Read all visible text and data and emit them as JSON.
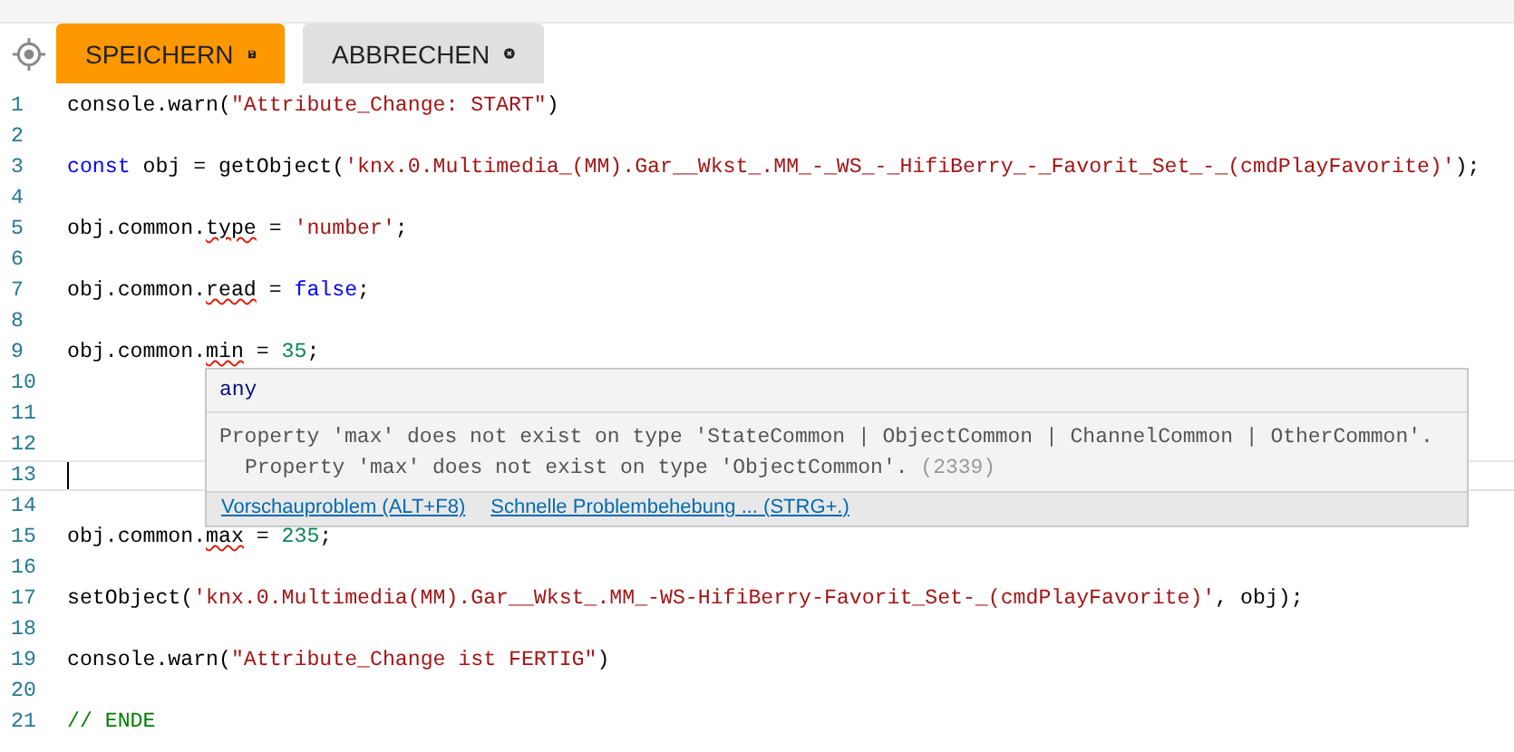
{
  "toolbar": {
    "buttons": [
      {
        "label": "SPEICHERN",
        "kind": "save"
      },
      {
        "label": "ABBRECHEN",
        "kind": "cancel"
      }
    ]
  },
  "editor": {
    "lines": [
      {
        "number": "1",
        "current": false,
        "tokens": [
          {
            "text": "console.warn(",
            "kind": "plain"
          },
          {
            "text": "\"Attribute_Change: START\"",
            "kind": "string"
          },
          {
            "text": ")",
            "kind": "plain"
          }
        ]
      },
      {
        "number": "2",
        "current": false
      },
      {
        "number": "3",
        "current": false,
        "tokens": [
          {
            "text": "const",
            "kind": "keyword"
          },
          {
            "text": " obj = getObject(",
            "kind": "plain"
          },
          {
            "text": "'knx.0.Multimedia_(MM).Gar__Wkst_.MM_-_WS_-_HifiBerry_-_Favorit_Set_-_(cmdPlayFavorite)'",
            "kind": "string"
          },
          {
            "text": ");",
            "kind": "plain"
          }
        ]
      },
      {
        "number": "4",
        "current": false
      },
      {
        "number": "5",
        "current": false,
        "tokens": [
          {
            "text": "obj.common.",
            "kind": "plain"
          },
          {
            "text": "type",
            "kind": "error"
          },
          {
            "text": " = ",
            "kind": "plain"
          },
          {
            "text": "'number'",
            "kind": "string"
          },
          {
            "text": ";",
            "kind": "plain"
          }
        ]
      },
      {
        "number": "6",
        "current": false
      },
      {
        "number": "7",
        "current": false,
        "tokens": [
          {
            "text": "obj.common.",
            "kind": "plain"
          },
          {
            "text": "read",
            "kind": "error"
          },
          {
            "text": " = ",
            "kind": "plain"
          },
          {
            "text": "false",
            "kind": "keyword"
          },
          {
            "text": ";",
            "kind": "plain"
          }
        ]
      },
      {
        "number": "8",
        "current": false
      },
      {
        "number": "9",
        "current": false,
        "tokens": [
          {
            "text": "obj.common.",
            "kind": "plain"
          },
          {
            "text": "min",
            "kind": "error"
          },
          {
            "text": " = ",
            "kind": "plain"
          },
          {
            "text": "35",
            "kind": "number"
          },
          {
            "text": ";",
            "kind": "plain"
          }
        ]
      },
      {
        "number": "10",
        "current": false
      },
      {
        "number": "11",
        "current": false
      },
      {
        "number": "12",
        "current": false
      },
      {
        "number": "13",
        "current": true
      },
      {
        "number": "14",
        "current": false
      },
      {
        "number": "15",
        "current": false,
        "tokens": [
          {
            "text": "obj.common.",
            "kind": "plain"
          },
          {
            "text": "max",
            "kind": "error"
          },
          {
            "text": " = ",
            "kind": "plain"
          },
          {
            "text": "235",
            "kind": "number"
          },
          {
            "text": ";",
            "kind": "plain"
          }
        ]
      },
      {
        "number": "16",
        "current": false
      },
      {
        "number": "17",
        "current": false,
        "tokens": [
          {
            "text": "setObject(",
            "kind": "plain"
          },
          {
            "text": "'knx.0.Multimedia(MM).Gar__Wkst_.MM_-WS-HifiBerry-Favorit_Set-_(cmdPlayFavorite)'",
            "kind": "string"
          },
          {
            "text": ", obj);",
            "kind": "plain"
          }
        ]
      },
      {
        "number": "18",
        "current": false
      },
      {
        "number": "19",
        "current": false,
        "tokens": [
          {
            "text": "console.warn(",
            "kind": "plain"
          },
          {
            "text": "\"Attribute_Change ist FERTIG\"",
            "kind": "string"
          },
          {
            "text": ")",
            "kind": "plain"
          }
        ]
      },
      {
        "number": "20",
        "current": false
      },
      {
        "number": "21",
        "current": false,
        "tokens": [
          {
            "text": "// ENDE",
            "kind": "comment"
          }
        ]
      }
    ]
  },
  "hover": {
    "type": "any",
    "message": "Property 'max' does not exist on type 'StateCommon | ObjectCommon | ChannelCommon | OtherCommon'.",
    "detail": "Property 'max' does not exist on type 'ObjectCommon'.",
    "code": "(2339)",
    "actions": [
      "Vorschauproblem (ALT+F8)",
      "Schnelle Problembehebung ... (STRG+.)"
    ]
  }
}
